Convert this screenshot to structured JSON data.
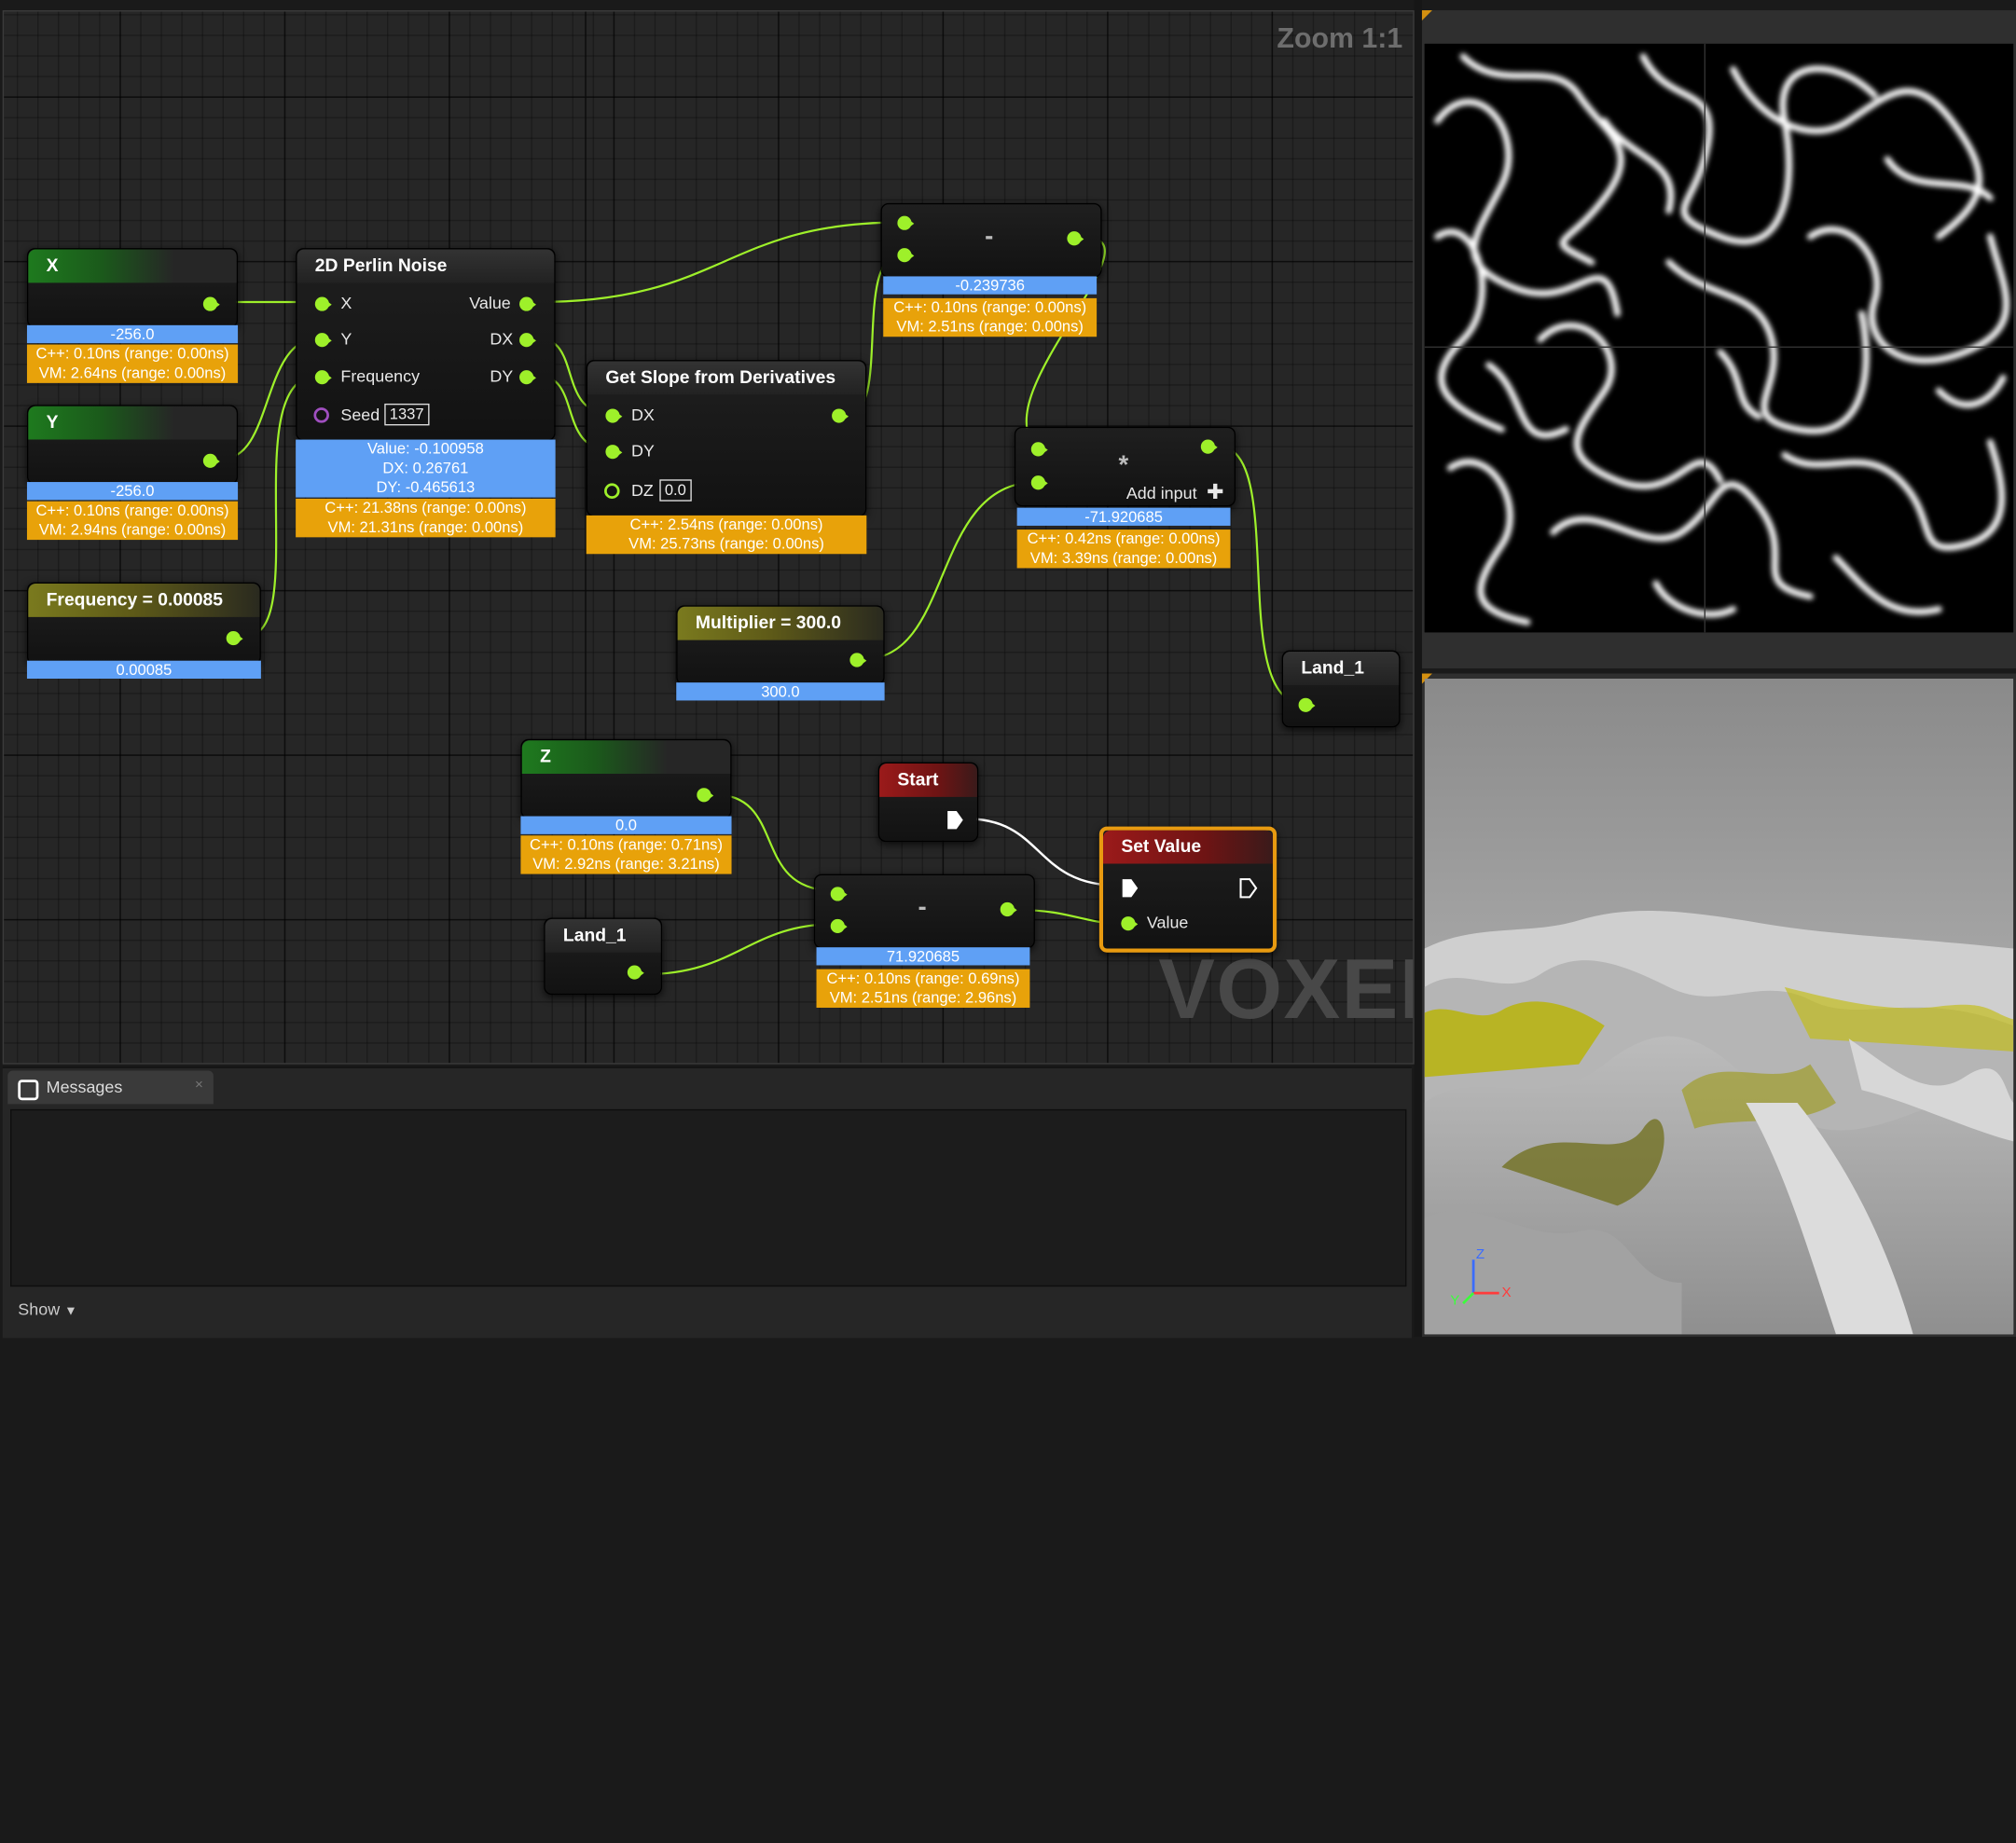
{
  "graph": {
    "zoom_label": "Zoom 1:1",
    "watermark": "VOXEL"
  },
  "nodes": {
    "x": {
      "title": "X",
      "value": "-256.0",
      "cpp": "C++: 0.10ns (range: 0.00ns)",
      "vm": "VM: 2.64ns (range: 0.00ns)"
    },
    "y": {
      "title": "Y",
      "value": "-256.0",
      "cpp": "C++: 0.10ns (range: 0.00ns)",
      "vm": "VM: 2.94ns (range: 0.00ns)"
    },
    "frequency": {
      "title": "Frequency = 0.00085",
      "value": "0.00085"
    },
    "perlin": {
      "title": "2D Perlin Noise",
      "in_x": "X",
      "in_y": "Y",
      "in_frequency": "Frequency",
      "in_seed": "Seed",
      "seed_value": "1337",
      "out_value": "Value",
      "out_dx": "DX",
      "out_dy": "DY",
      "result_value": "Value: -0.100958",
      "result_dx": "DX: 0.26761",
      "result_dy": "DY: -0.465613",
      "cpp": "C++: 21.38ns (range: 0.00ns)",
      "vm": "VM: 21.31ns (range: 0.00ns)"
    },
    "slope": {
      "title": "Get Slope from Derivatives",
      "in_dx": "DX",
      "in_dy": "DY",
      "in_dz": "DZ",
      "dz_value": "0.0",
      "cpp": "C++: 2.54ns (range: 0.00ns)",
      "vm": "VM: 25.73ns (range: 0.00ns)"
    },
    "subtract_top": {
      "op": "-",
      "value": "-0.239736",
      "cpp": "C++: 0.10ns (range: 0.00ns)",
      "vm": "VM: 2.51ns (range: 0.00ns)"
    },
    "multiply": {
      "op": "*",
      "add_input": "Add input",
      "value": "-71.920685",
      "cpp": "C++: 0.42ns (range: 0.00ns)",
      "vm": "VM: 3.39ns (range: 0.00ns)"
    },
    "multiplier": {
      "title": "Multiplier = 300.0",
      "value": "300.0"
    },
    "land_out": {
      "title": "Land_1"
    },
    "z": {
      "title": "Z",
      "value": "0.0",
      "cpp": "C++: 0.10ns (range: 0.71ns)",
      "vm": "VM: 2.92ns (range: 3.21ns)"
    },
    "land_in": {
      "title": "Land_1"
    },
    "subtract_bottom": {
      "op": "-",
      "value": "71.920685",
      "cpp": "C++: 0.10ns (range: 0.69ns)",
      "vm": "VM: 2.51ns (range: 2.96ns)"
    },
    "start": {
      "title": "Start"
    },
    "set_value": {
      "title": "Set Value",
      "in_value": "Value"
    }
  },
  "messages": {
    "tab_label": "Messages",
    "close_label": "×",
    "show_label": "Show"
  },
  "viewport": {
    "axis_z": "Z",
    "axis_x": "X",
    "axis_y": "Y"
  },
  "colors": {
    "pin": "#9ef02a",
    "value_bar": "#5fa0f5",
    "timing_bar": "#e8a20a",
    "selection": "#e89a10"
  }
}
